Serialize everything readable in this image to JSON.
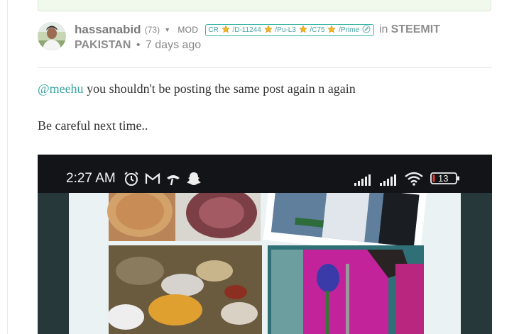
{
  "comment": {
    "author": "hassanabid",
    "reputation": "(73)",
    "role": "MOD",
    "badge": {
      "cr": "CR",
      "d": "/D-11244",
      "pu": "/Pu-L3",
      "c": "/C75",
      "prime": "/Prime"
    },
    "in_word": "in",
    "community_part1": "STEEMIT",
    "community_part2": "PAKISTAN",
    "separator": "•",
    "time": "7 days ago",
    "mention": "@meehu",
    "line1_rest": " you shouldn't be posting the same post again n again",
    "line2": "Be careful next time.."
  },
  "phone_status": {
    "time": "2:27 AM",
    "battery": "13"
  },
  "icons": [
    "caret-down-icon",
    "star-icon",
    "pencil-icon",
    "alarm-icon",
    "gmail-icon",
    "call-icon",
    "snapchat-icon",
    "signal-icon",
    "wifi-icon",
    "battery-icon"
  ],
  "colors": {
    "mention": "#3aa5a0",
    "badge_border": "#38b4a5",
    "battery_low": "#e53935"
  }
}
